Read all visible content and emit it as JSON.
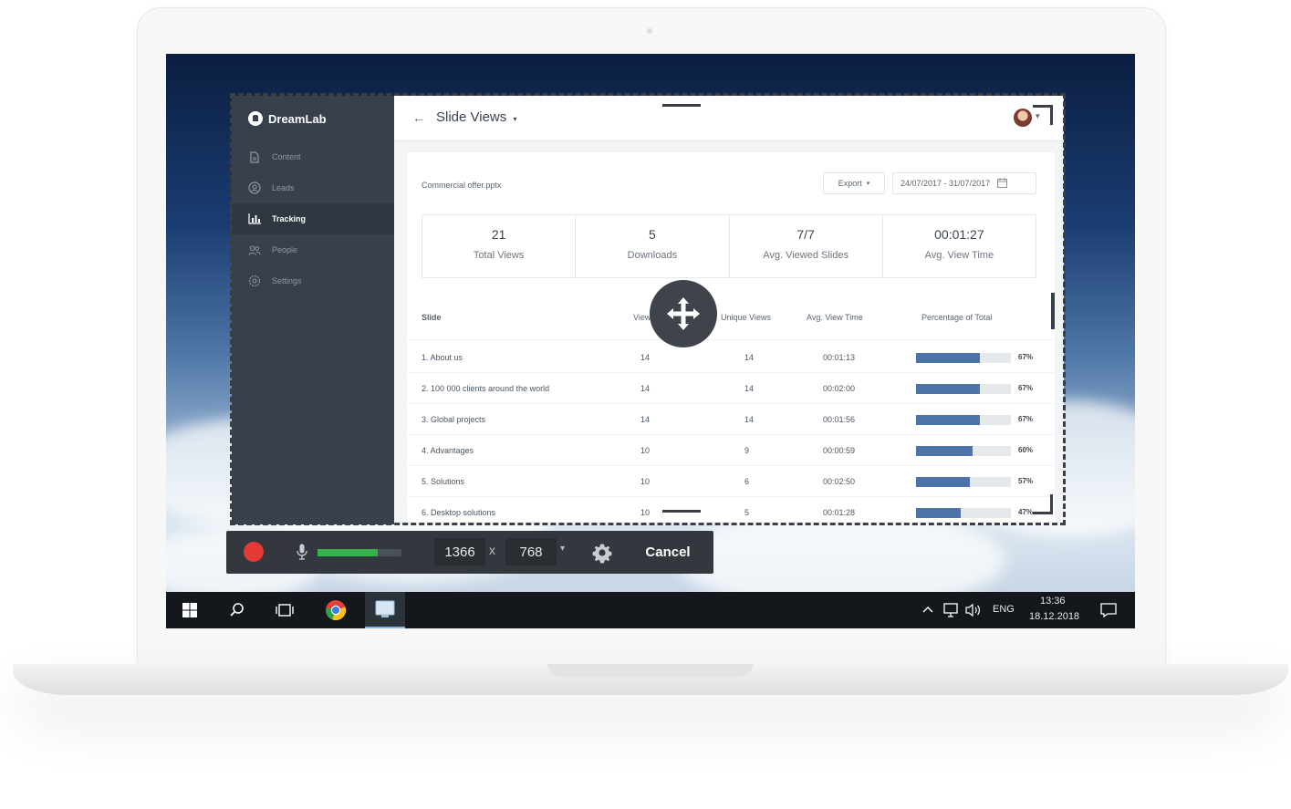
{
  "sidebar": {
    "brand": "DreamLab",
    "items": [
      {
        "label": "Content",
        "icon": "document-icon"
      },
      {
        "label": "Leads",
        "icon": "user-circle-icon"
      },
      {
        "label": "Tracking",
        "icon": "bar-chart-icon",
        "active": true
      },
      {
        "label": "People",
        "icon": "people-icon"
      },
      {
        "label": "Settings",
        "icon": "gear-icon"
      }
    ]
  },
  "header": {
    "back": "←",
    "title": "Slide Views",
    "title_caret": "▾",
    "avatar_caret": "▾"
  },
  "card": {
    "file_name": "Commercial offer.pptx",
    "export_label": "Export",
    "export_caret": "▾",
    "date_range": "24/07/2017 - 31/07/2017"
  },
  "stats": [
    {
      "value": "21",
      "label": "Total Views"
    },
    {
      "value": "5",
      "label": "Downloads"
    },
    {
      "value": "7/7",
      "label": "Avg. Viewed Slides"
    },
    {
      "value": "00:01:27",
      "label": "Avg. View Time"
    }
  ],
  "table": {
    "headers": {
      "slide": "Slide",
      "views": "Views",
      "unique_views": "Unique Views",
      "avg_view_time": "Avg. View Time",
      "percentage": "Percentage of Total"
    },
    "rows": [
      {
        "slide": "1. About us",
        "views": "14",
        "unique": "14",
        "time": "00:01:13",
        "pct_label": "67%",
        "pct": 0.67
      },
      {
        "slide": "2. 100 000 clients around the world",
        "views": "14",
        "unique": "14",
        "time": "00:02:00",
        "pct_label": "67%",
        "pct": 0.67
      },
      {
        "slide": "3. Global projects",
        "views": "14",
        "unique": "14",
        "time": "00:01:56",
        "pct_label": "67%",
        "pct": 0.67
      },
      {
        "slide": "4. Advantages",
        "views": "10",
        "unique": "9",
        "time": "00:00:59",
        "pct_label": "60%",
        "pct": 0.6
      },
      {
        "slide": "5. Solutions",
        "views": "10",
        "unique": "6",
        "time": "00:02:50",
        "pct_label": "57%",
        "pct": 0.57
      },
      {
        "slide": "6. Desktop solutions",
        "views": "10",
        "unique": "5",
        "time": "00:01:28",
        "pct_label": "47%",
        "pct": 0.47
      }
    ]
  },
  "recorder": {
    "mic_level": 0.72,
    "width": "1366",
    "times": "x",
    "height": "768",
    "size_caret": "▾",
    "cancel_label": "Cancel",
    "record_color": "#e53935"
  },
  "taskbar": {
    "language": "ENG",
    "time": "13:36",
    "date": "18.12.2018"
  }
}
